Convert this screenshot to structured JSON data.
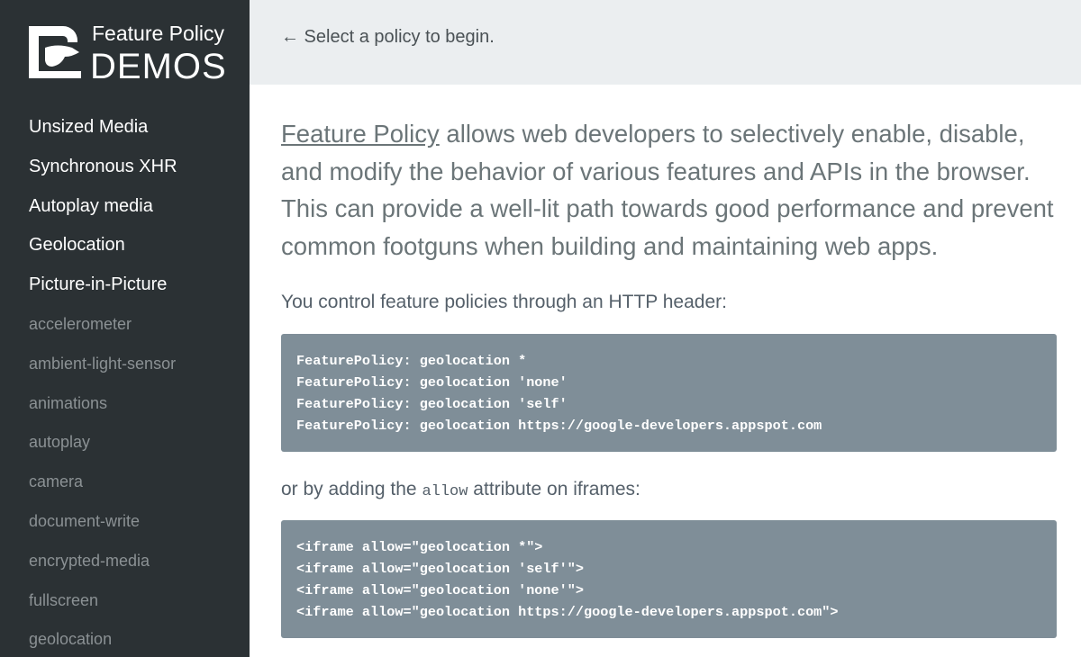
{
  "brand": {
    "line1": "Feature Policy",
    "line2": "DEMOS",
    "logo_icon": "chrome-logo-icon"
  },
  "sidebar": {
    "items": [
      {
        "label": "Unsized Media",
        "style": "primary"
      },
      {
        "label": "Synchronous XHR",
        "style": "primary"
      },
      {
        "label": "Autoplay media",
        "style": "primary"
      },
      {
        "label": "Geolocation",
        "style": "primary"
      },
      {
        "label": "Picture-in-Picture",
        "style": "primary"
      },
      {
        "label": "accelerometer",
        "style": "secondary"
      },
      {
        "label": "ambient-light-sensor",
        "style": "secondary"
      },
      {
        "label": "animations",
        "style": "secondary"
      },
      {
        "label": "autoplay",
        "style": "secondary"
      },
      {
        "label": "camera",
        "style": "secondary"
      },
      {
        "label": "document-write",
        "style": "secondary"
      },
      {
        "label": "encrypted-media",
        "style": "secondary"
      },
      {
        "label": "fullscreen",
        "style": "secondary"
      },
      {
        "label": "geolocation",
        "style": "secondary"
      }
    ]
  },
  "topbar": {
    "message": "← Select a policy to begin."
  },
  "main": {
    "intro_link": "Feature Policy",
    "intro_rest": " allows web developers to selectively enable, disable, and modify the behavior of various features and APIs in the browser. This can provide a well-lit path towards good performance and prevent common footguns when building and maintaining web apps.",
    "header_para": "You control feature policies through an HTTP header:",
    "header_code": [
      "FeaturePolicy: geolocation *",
      "FeaturePolicy: geolocation 'none'",
      "FeaturePolicy: geolocation 'self'",
      "FeaturePolicy: geolocation https://google-developers.appspot.com"
    ],
    "iframe_para_before": "or by adding the ",
    "iframe_para_code": "allow",
    "iframe_para_after": " attribute on iframes:",
    "iframe_code": [
      "<iframe allow=\"geolocation *\">",
      "<iframe allow=\"geolocation 'self'\">",
      "<iframe allow=\"geolocation 'none'\">",
      "<iframe allow=\"geolocation https://google-developers.appspot.com\">"
    ]
  },
  "colors": {
    "sidebar_bg": "#2b3134",
    "topbar_bg": "#ebeef0",
    "code_bg": "#7f8e98"
  }
}
